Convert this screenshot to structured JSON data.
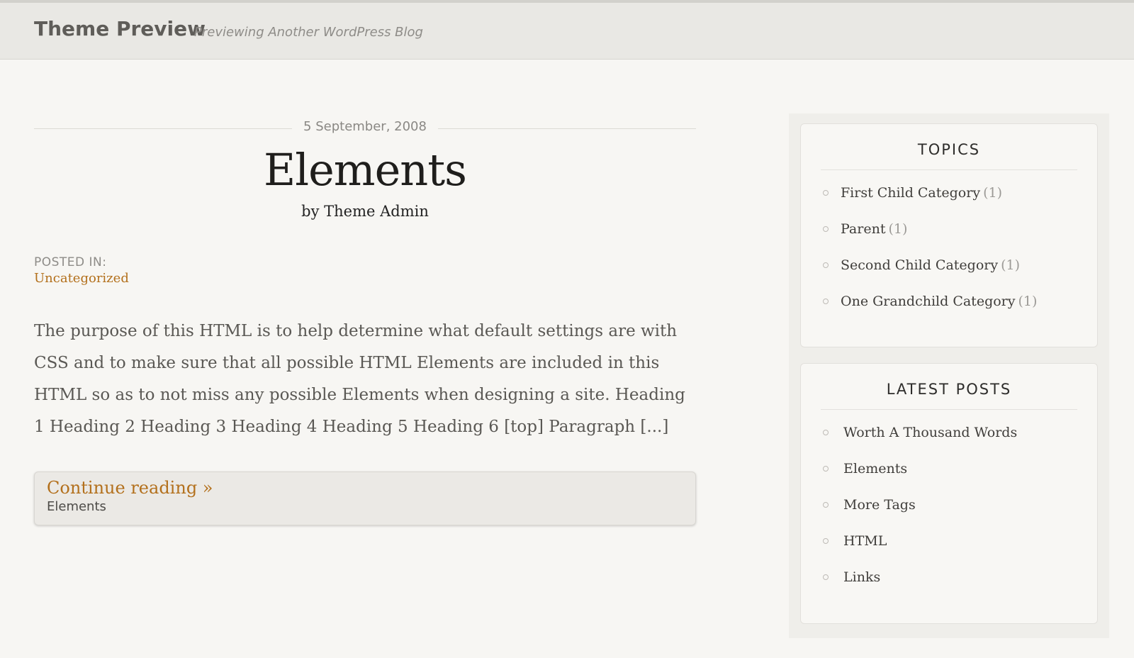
{
  "header": {
    "site_title": "Theme Preview",
    "site_description": "Previewing Another WordPress Blog"
  },
  "post": {
    "date": "5 September, 2008",
    "title": "Elements",
    "byline": "by Theme Admin",
    "posted_in_label": "POSTED IN:",
    "category": "Uncategorized",
    "excerpt": "The purpose of this HTML is to help determine what default settings are with CSS and to make sure that all possible HTML Elements are included in this HTML so as to not miss any possible Elements when designing a site. Heading 1 Heading 2 Heading 3 Heading 4 Heading 5 Heading 6 [top] Paragraph [...]",
    "continue_label": "Continue reading »",
    "continue_sub": "Elements"
  },
  "sidebar": {
    "topics": {
      "title": "TOPICS",
      "items": [
        {
          "label": "First Child Category",
          "count": "(1)"
        },
        {
          "label": "Parent",
          "count": "(1)"
        },
        {
          "label": "Second Child Category",
          "count": "(1)"
        },
        {
          "label": "One Grandchild Category",
          "count": "(1)"
        }
      ]
    },
    "latest_posts": {
      "title": "LATEST POSTS",
      "items": [
        {
          "label": "Worth A Thousand Words"
        },
        {
          "label": "Elements"
        },
        {
          "label": "More Tags"
        },
        {
          "label": "HTML"
        },
        {
          "label": "Links"
        }
      ]
    }
  },
  "colors": {
    "accent_link": "#b3701c",
    "background": "#f7f6f3",
    "header_background": "#e9e8e4"
  }
}
